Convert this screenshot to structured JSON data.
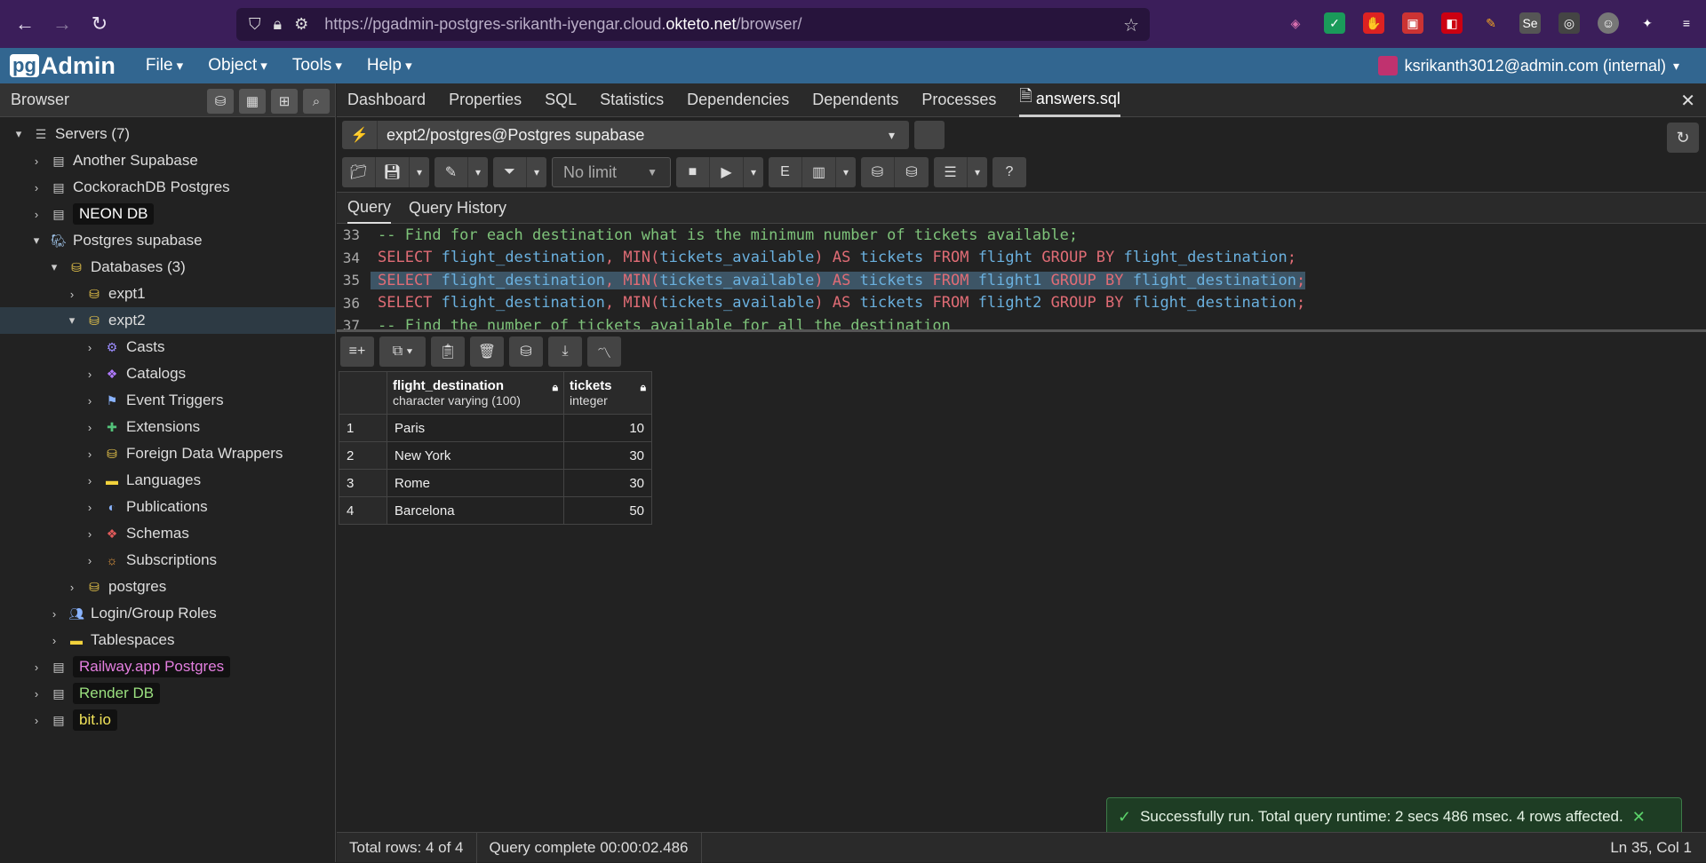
{
  "browser": {
    "url_prefix": "https://pgadmin-postgres-srikanth-iyengar.cloud.",
    "url_domain": "okteto.net",
    "url_suffix": "/browser/"
  },
  "app": {
    "menu": [
      "File",
      "Object",
      "Tools",
      "Help"
    ],
    "user": "ksrikanth3012@admin.com (internal)"
  },
  "browser_panel": {
    "title": "Browser"
  },
  "tree": [
    {
      "label": "Servers (7)",
      "indent": 0,
      "chev": "▾",
      "icon": "server-group-icon",
      "tag": false,
      "color": "#ddd"
    },
    {
      "label": "Another Supabase",
      "indent": 1,
      "chev": "›",
      "icon": "server-icon",
      "tag": false,
      "color": "#ddd"
    },
    {
      "label": "CockorachDB Postgres",
      "indent": 1,
      "chev": "›",
      "icon": "server-icon",
      "tag": false,
      "color": "#ddd"
    },
    {
      "label": "NEON DB",
      "indent": 1,
      "chev": "›",
      "icon": "server-icon",
      "tag": true,
      "color": "#fff"
    },
    {
      "label": "Postgres supabase",
      "indent": 1,
      "chev": "▾",
      "icon": "elephant-icon",
      "tag": false,
      "color": "#ddd"
    },
    {
      "label": "Databases (3)",
      "indent": 2,
      "chev": "▾",
      "icon": "databases-icon",
      "tag": false,
      "color": "#ddd"
    },
    {
      "label": "expt1",
      "indent": 3,
      "chev": "›",
      "icon": "database-icon",
      "tag": false,
      "color": "#ddd"
    },
    {
      "label": "expt2",
      "indent": 3,
      "chev": "▾",
      "icon": "database-icon",
      "tag": false,
      "color": "#ddd",
      "selected": true
    },
    {
      "label": "Casts",
      "indent": 4,
      "chev": "›",
      "icon": "casts-icon",
      "tag": false,
      "color": "#ddd"
    },
    {
      "label": "Catalogs",
      "indent": 4,
      "chev": "›",
      "icon": "catalogs-icon",
      "tag": false,
      "color": "#ddd"
    },
    {
      "label": "Event Triggers",
      "indent": 4,
      "chev": "›",
      "icon": "event-triggers-icon",
      "tag": false,
      "color": "#ddd"
    },
    {
      "label": "Extensions",
      "indent": 4,
      "chev": "›",
      "icon": "extensions-icon",
      "tag": false,
      "color": "#ddd"
    },
    {
      "label": "Foreign Data Wrappers",
      "indent": 4,
      "chev": "›",
      "icon": "foreign-data-wrappers-icon",
      "tag": false,
      "color": "#ddd"
    },
    {
      "label": "Languages",
      "indent": 4,
      "chev": "›",
      "icon": "languages-icon",
      "tag": false,
      "color": "#ddd"
    },
    {
      "label": "Publications",
      "indent": 4,
      "chev": "›",
      "icon": "publications-icon",
      "tag": false,
      "color": "#ddd"
    },
    {
      "label": "Schemas",
      "indent": 4,
      "chev": "›",
      "icon": "schemas-icon",
      "tag": false,
      "color": "#ddd"
    },
    {
      "label": "Subscriptions",
      "indent": 4,
      "chev": "›",
      "icon": "subscriptions-icon",
      "tag": false,
      "color": "#ddd"
    },
    {
      "label": "postgres",
      "indent": 3,
      "chev": "›",
      "icon": "database-icon",
      "tag": false,
      "color": "#ddd"
    },
    {
      "label": "Login/Group Roles",
      "indent": 2,
      "chev": "›",
      "icon": "roles-icon",
      "tag": false,
      "color": "#ddd"
    },
    {
      "label": "Tablespaces",
      "indent": 2,
      "chev": "›",
      "icon": "tablespaces-icon",
      "tag": false,
      "color": "#ddd"
    },
    {
      "label": "Railway.app Postgres",
      "indent": 1,
      "chev": "›",
      "icon": "server-icon",
      "tag": true,
      "color": "#e47fe0"
    },
    {
      "label": "Render DB",
      "indent": 1,
      "chev": "›",
      "icon": "server-icon",
      "tag": true,
      "color": "#9be07f"
    },
    {
      "label": "bit.io",
      "indent": 1,
      "chev": "›",
      "icon": "server-icon",
      "tag": true,
      "color": "#f1e35a"
    }
  ],
  "tabs": [
    "Dashboard",
    "Properties",
    "SQL",
    "Statistics",
    "Dependencies",
    "Dependents",
    "Processes",
    "answers.sql"
  ],
  "connection": "expt2/postgres@Postgres supabase",
  "limit": "No limit",
  "query_tabs": [
    "Query",
    "Query History"
  ],
  "code_lines": [
    {
      "num": "33",
      "kind": "comment",
      "text": "-- Find for each destination what is the minimum number of tickets available;"
    },
    {
      "num": "34",
      "kind": "sql",
      "table": "flight"
    },
    {
      "num": "35",
      "kind": "sql",
      "table": "flight1",
      "highlight": true
    },
    {
      "num": "36",
      "kind": "sql",
      "table": "flight2"
    },
    {
      "num": "37",
      "kind": "comment",
      "text": "-- Find the number of tickets available for all the destination"
    }
  ],
  "grid": {
    "columns": [
      {
        "name": "flight_destination",
        "type": "character varying (100)"
      },
      {
        "name": "tickets",
        "type": "integer"
      }
    ],
    "rows": [
      [
        "1",
        "Paris",
        "10"
      ],
      [
        "2",
        "New York",
        "30"
      ],
      [
        "3",
        "Rome",
        "30"
      ],
      [
        "4",
        "Barcelona",
        "50"
      ]
    ]
  },
  "toast": "Successfully run. Total query runtime: 2 secs 486 msec. 4 rows affected.",
  "status": {
    "rows": "Total rows: 4 of 4",
    "complete": "Query complete 00:00:02.486",
    "position": "Ln 35, Col 1"
  }
}
